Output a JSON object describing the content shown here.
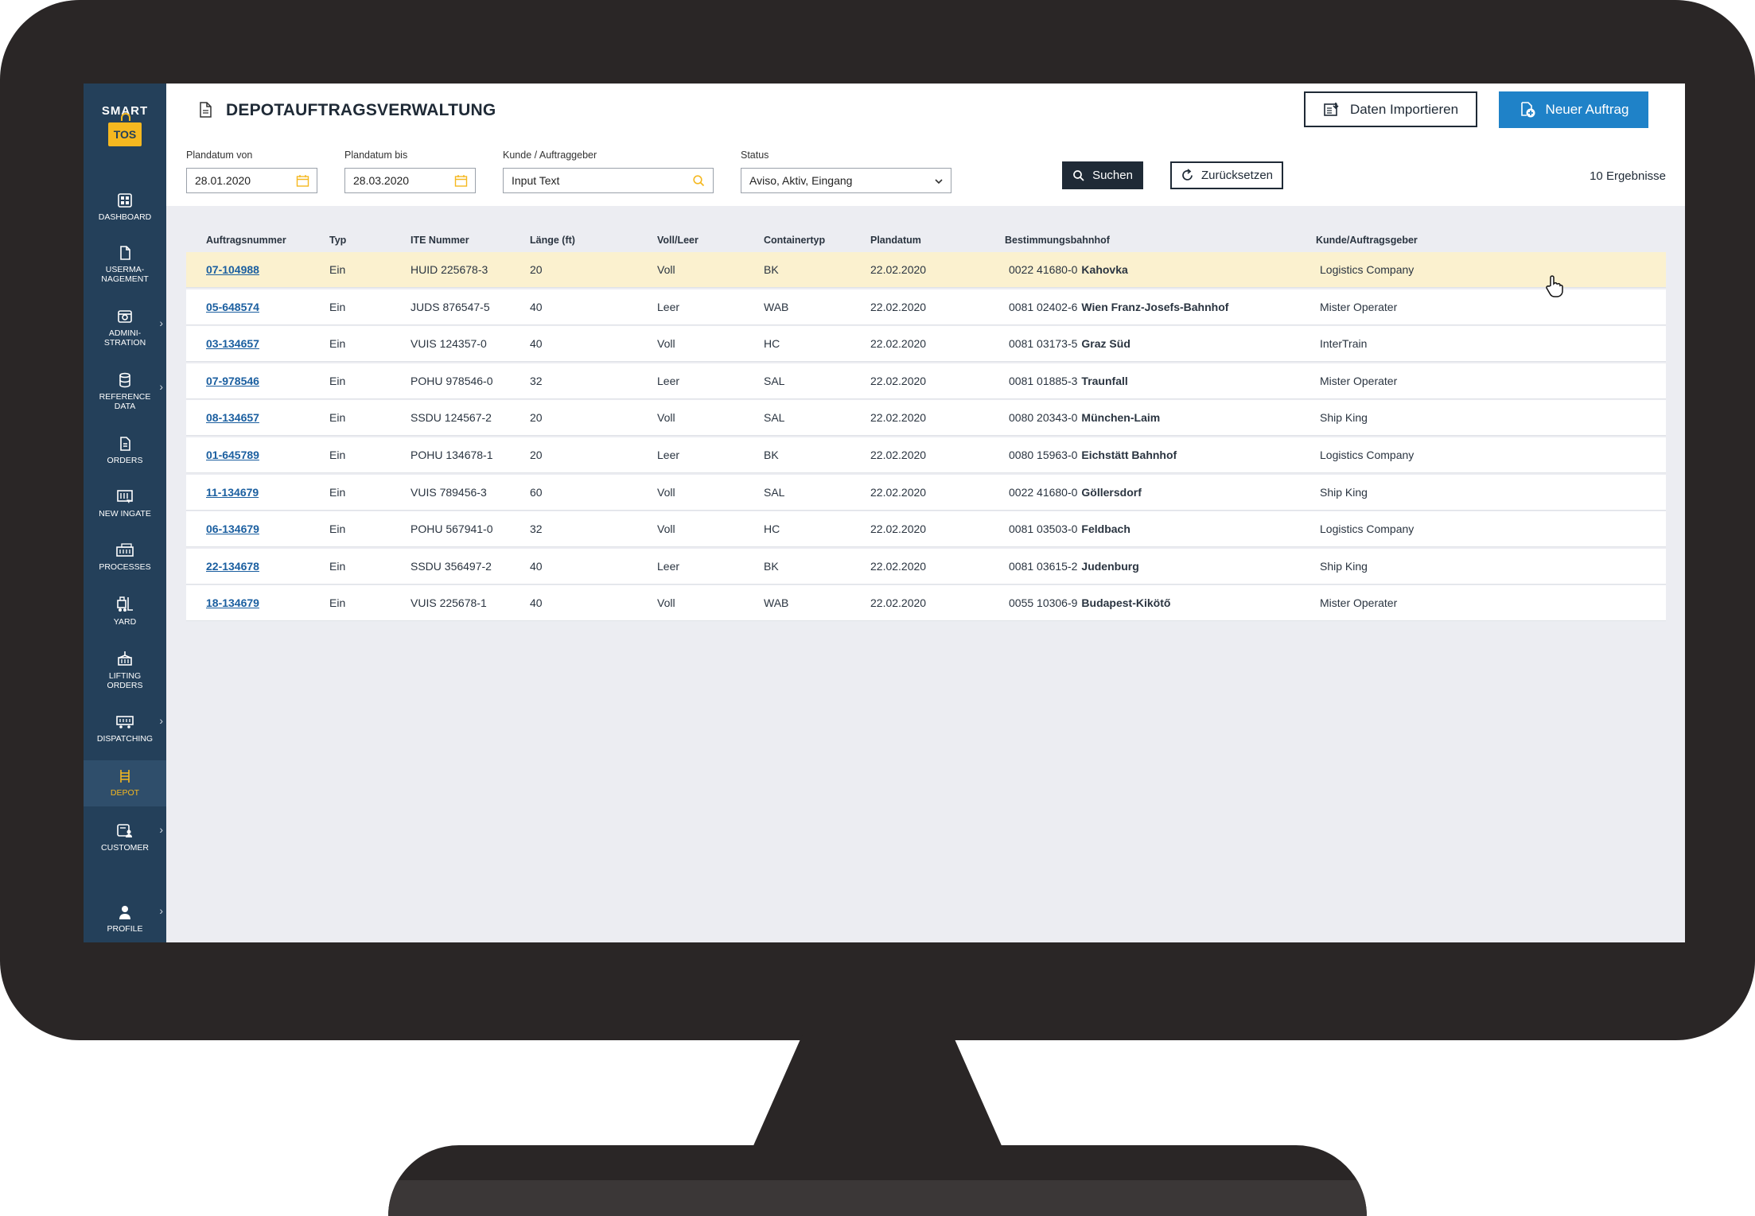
{
  "app": {
    "logo_top": "SMART",
    "logo_bottom": "TOS"
  },
  "sidebar": {
    "items": [
      {
        "label": "DASHBOARD",
        "icon": "dashboard-icon"
      },
      {
        "label": "USERMA-\nNAGEMENT",
        "icon": "document-icon"
      },
      {
        "label": "ADMINI-\nSTRATION",
        "icon": "admin-icon"
      },
      {
        "label": "REFERENCE\nDATA",
        "icon": "database-icon"
      },
      {
        "label": "ORDERS",
        "icon": "orders-icon"
      },
      {
        "label": "NEW INGATE",
        "icon": "ingate-icon"
      },
      {
        "label": "PROCESSES",
        "icon": "processes-icon"
      },
      {
        "label": "YARD",
        "icon": "forklift-icon"
      },
      {
        "label": "LIFTING\nORDERS",
        "icon": "lifting-icon"
      },
      {
        "label": "DISPATCHING",
        "icon": "train-icon"
      },
      {
        "label": "DEPOT",
        "icon": "ladder-icon",
        "active": true
      },
      {
        "label": "CUSTOMER",
        "icon": "customer-icon"
      },
      {
        "label": "PROFILE",
        "icon": "user-icon"
      }
    ]
  },
  "header": {
    "title": "DEPOTAUFTRAGSVERWALTUNG",
    "import_label": "Daten Importieren",
    "new_label": "Neuer Auftrag"
  },
  "filters": {
    "from_label": "Plandatum von",
    "from_value": "28.01.2020",
    "to_label": "Plandatum bis",
    "to_value": "28.03.2020",
    "customer_label": "Kunde / Auftraggeber",
    "customer_value": "Input Text",
    "status_label": "Status",
    "status_value": "Aviso, Aktiv, Eingang",
    "search_label": "Suchen",
    "reset_label": "Zurücksetzen",
    "results": "10 Ergebnisse"
  },
  "table": {
    "headers": [
      "Auftragsnummer",
      "Typ",
      "ITE Nummer",
      "Länge (ft)",
      "Voll/Leer",
      "Containertyp",
      "Plandatum",
      "Bestimmungsbahnhof",
      "Kunde/Auftragsgeber"
    ],
    "rows": [
      {
        "order": "07-104988",
        "typ": "Ein",
        "ite": "HUID 225678-3",
        "len": "20",
        "fe": "Voll",
        "ctype": "BK",
        "date": "22.02.2020",
        "station_code": "0022 41680-0",
        "station_name": "Kahovka",
        "customer": "Logistics Company"
      },
      {
        "order": "05-648574",
        "typ": "Ein",
        "ite": "JUDS 876547-5",
        "len": "40",
        "fe": "Leer",
        "ctype": "WAB",
        "date": "22.02.2020",
        "station_code": "0081 02402-6",
        "station_name": "Wien Franz-Josefs-Bahnhof",
        "customer": "Mister Operater"
      },
      {
        "order": "03-134657",
        "typ": "Ein",
        "ite": "VUIS 124357-0",
        "len": "40",
        "fe": "Voll",
        "ctype": "HC",
        "date": "22.02.2020",
        "station_code": "0081 03173-5",
        "station_name": "Graz Süd",
        "customer": "InterTrain"
      },
      {
        "order": "07-978546",
        "typ": "Ein",
        "ite": "POHU 978546-0",
        "len": "32",
        "fe": "Leer",
        "ctype": "SAL",
        "date": "22.02.2020",
        "station_code": "0081 01885-3",
        "station_name": "Traunfall",
        "customer": "Mister Operater"
      },
      {
        "order": "08-134657",
        "typ": "Ein",
        "ite": "SSDU 124567-2",
        "len": "20",
        "fe": "Voll",
        "ctype": "SAL",
        "date": "22.02.2020",
        "station_code": "0080 20343-0",
        "station_name": "München-Laim",
        "customer": "Ship King"
      },
      {
        "order": "01-645789",
        "typ": "Ein",
        "ite": "POHU 134678-1",
        "len": "20",
        "fe": "Leer",
        "ctype": "BK",
        "date": "22.02.2020",
        "station_code": "0080 15963-0",
        "station_name": "Eichstätt Bahnhof",
        "customer": "Logistics Company"
      },
      {
        "order": "11-134679",
        "typ": "Ein",
        "ite": "VUIS 789456-3",
        "len": "60",
        "fe": "Voll",
        "ctype": "SAL",
        "date": "22.02.2020",
        "station_code": "0022 41680-0",
        "station_name": "Göllersdorf",
        "customer": "Ship King"
      },
      {
        "order": "06-134679",
        "typ": "Ein",
        "ite": "POHU 567941-0",
        "len": "32",
        "fe": "Voll",
        "ctype": "HC",
        "date": "22.02.2020",
        "station_code": "0081 03503-0",
        "station_name": "Feldbach",
        "customer": "Logistics Company"
      },
      {
        "order": "22-134678",
        "typ": "Ein",
        "ite": "SSDU 356497-2",
        "len": "40",
        "fe": "Leer",
        "ctype": "BK",
        "date": "22.02.2020",
        "station_code": "0081 03615-2",
        "station_name": "Judenburg",
        "customer": "Ship King"
      },
      {
        "order": "18-134679",
        "typ": "Ein",
        "ite": "VUIS 225678-1",
        "len": "40",
        "fe": "Voll",
        "ctype": "WAB",
        "date": "22.02.2020",
        "station_code": "0055 10306-9",
        "station_name": "Budapest-Kikötő",
        "customer": "Mister Operater"
      }
    ]
  },
  "colors": {
    "sidebar": "#24405a",
    "accent": "#f5b820",
    "primary": "#1f82c8",
    "highlight_row": "#fbf1cf"
  }
}
